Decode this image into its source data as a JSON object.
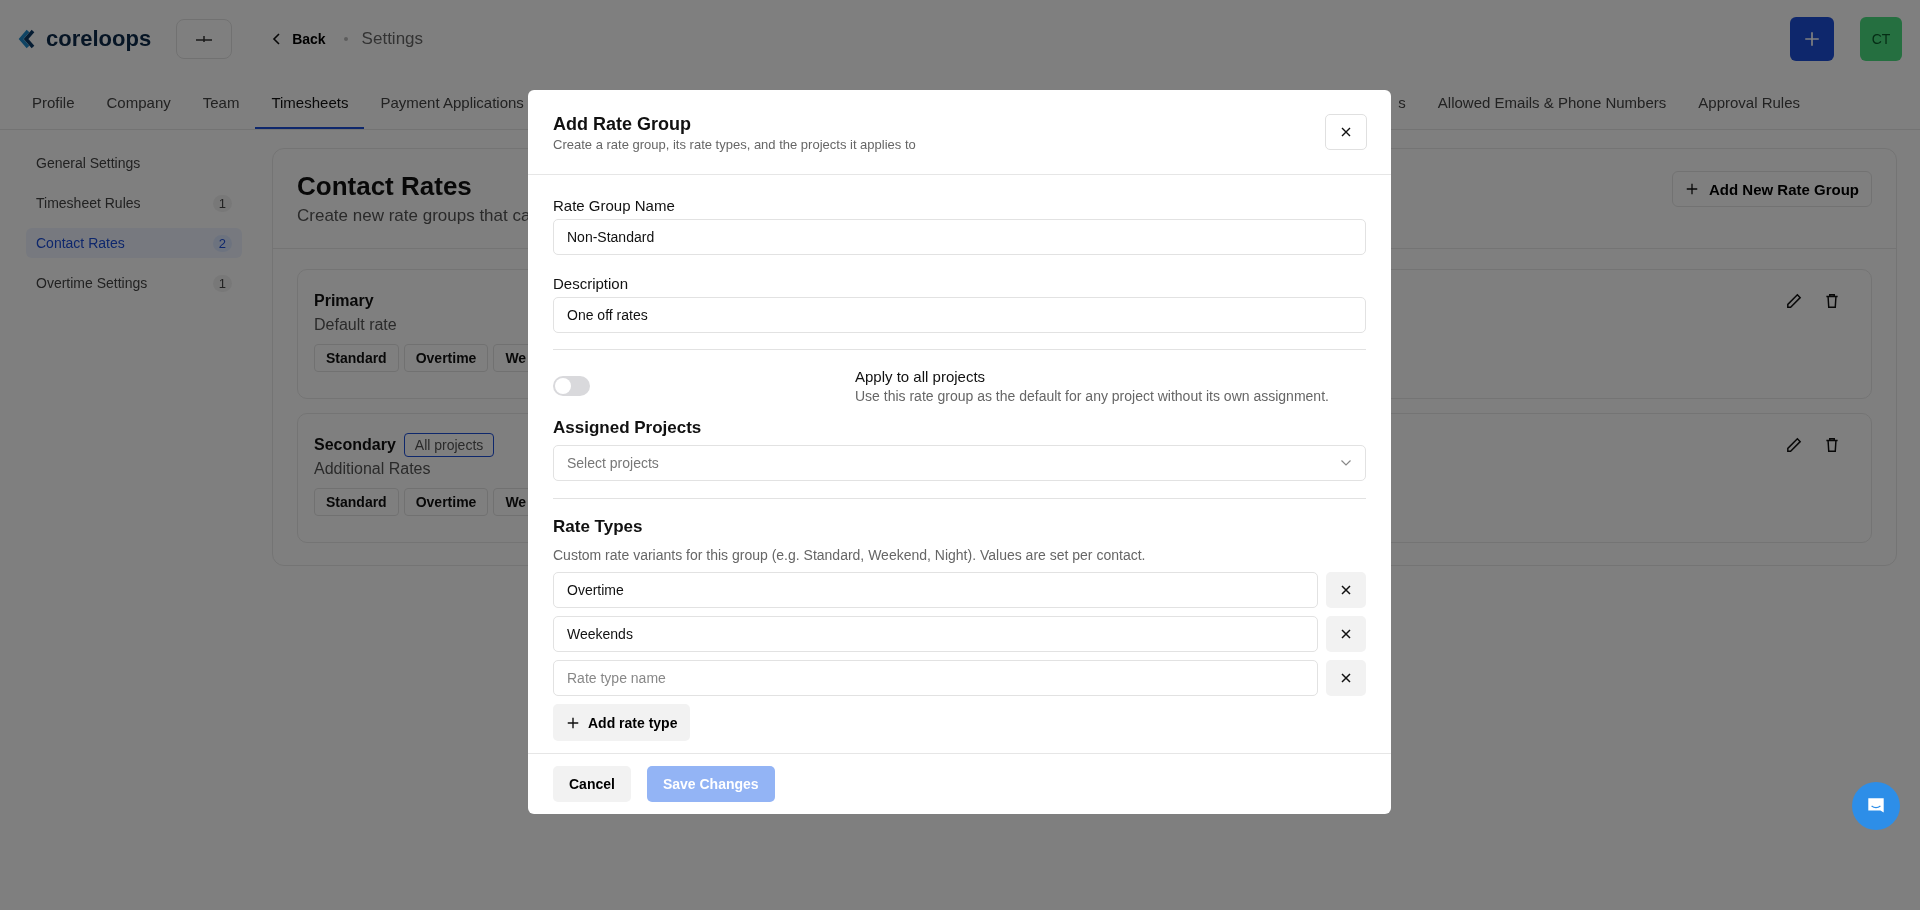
{
  "header": {
    "logo": "coreloops",
    "back": "Back",
    "breadcrumb": "Settings",
    "avatar": "CT"
  },
  "tabs": [
    {
      "label": "Profile",
      "selected": false
    },
    {
      "label": "Company",
      "selected": false
    },
    {
      "label": "Team",
      "selected": false
    },
    {
      "label": "Timesheets",
      "selected": true
    },
    {
      "label": "Payment Applications",
      "selected": false
    },
    {
      "label": "s",
      "selected": false
    },
    {
      "label": "Allowed Emails & Phone Numbers",
      "selected": false
    },
    {
      "label": "Approval Rules",
      "selected": false
    }
  ],
  "sidebar": {
    "items": [
      {
        "label": "General Settings",
        "selected": false
      },
      {
        "label": "Timesheet Rules",
        "count": "1",
        "selected": false
      },
      {
        "label": "Contact Rates",
        "count": "2",
        "selected": true
      },
      {
        "label": "Overtime Settings",
        "count": "1",
        "selected": false
      }
    ]
  },
  "content": {
    "title": "Contact Rates",
    "subtitle": "Create new rate groups that ca",
    "add_button": "Add New Rate Group",
    "groups": [
      {
        "name": "Primary",
        "description": "Default rate",
        "rate_types": [
          "Standard",
          "Overtime",
          "We"
        ]
      },
      {
        "name": "Secondary",
        "badge": "All projects",
        "description": "Additional Rates",
        "rate_types": [
          "Standard",
          "Overtime",
          "We"
        ]
      }
    ]
  },
  "modal": {
    "title": "Add Rate Group",
    "subtitle": "Create a rate group, its rate types, and the projects it applies to",
    "name_label": "Rate Group Name",
    "name_value": "Non-Standard",
    "description_label": "Description",
    "description_value": "One off rates",
    "apply_all": {
      "label": "Apply to all projects",
      "hint": "Use this rate group as the default for any project without its own assignment.",
      "on": false
    },
    "assigned_projects": {
      "label": "Assigned Projects",
      "placeholder": "Select projects"
    },
    "rate_types": {
      "title": "Rate Types",
      "hint": "Custom rate variants for this group (e.g. Standard, Weekend, Night). Values are set per contact.",
      "items": [
        {
          "value": "Overtime"
        },
        {
          "value": "Weekends"
        },
        {
          "placeholder": "Rate type name"
        }
      ],
      "add_button": "Add rate type"
    },
    "cancel_button": "Cancel",
    "save_button": {
      "label": "Save Changes",
      "disabled": true
    }
  }
}
